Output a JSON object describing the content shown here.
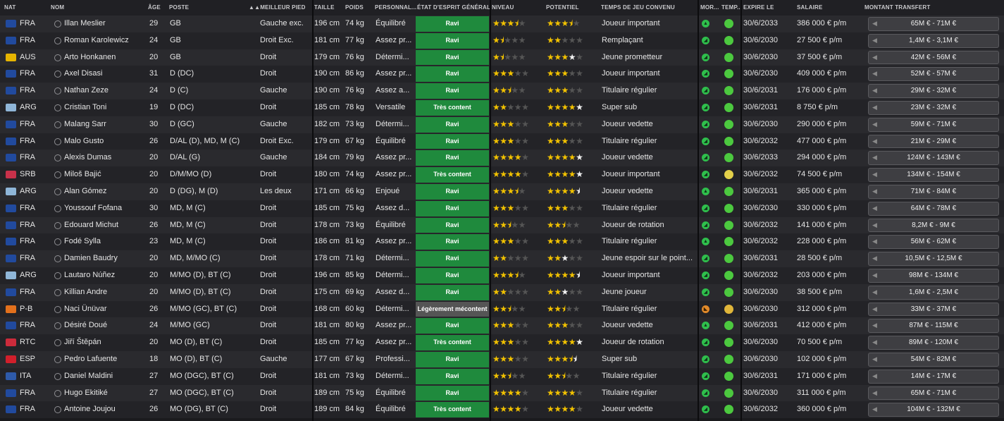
{
  "columns": {
    "nat": "NAT",
    "nom": "NOM",
    "age": "ÂGE",
    "poste": "POSTE",
    "meilleur_pied": "MEILLEUR PIED",
    "taille": "TAILLE",
    "poids": "POIDS",
    "personnalite": "PERSONNAL...",
    "etat_esprit": "ÉTAT D'ESPRIT GÉNÉRAL",
    "niveau": "NIVEAU",
    "potentiel": "POTENTIEL",
    "temps_jeu": "TEMPS DE JEU CONVENU",
    "moral": "MOR...",
    "temp": "TEMP...",
    "expire": "EXPIRE LE",
    "salaire": "SALAIRE",
    "transfert": "MONTANT TRANSFERT"
  },
  "players": [
    {
      "nat": "FRA",
      "nom": "Illan Meslier",
      "age": "29",
      "poste": "GB",
      "pied": "Gauche exc.",
      "taille": "196 cm",
      "poids": "74 kg",
      "perso": "Équilibré",
      "mood": "Ravi",
      "mood_kind": "ravi",
      "niveau": 3.5,
      "potentiel": 3.5,
      "temps": "Joueur important",
      "moral": "up",
      "happy": "happy",
      "expire": "30/6/2033",
      "salaire": "386 000 € p/m",
      "transfert": "65M € - 71M €"
    },
    {
      "nat": "FRA",
      "nom": "Roman Karolewicz",
      "age": "24",
      "poste": "GB",
      "pied": "Droit Exc.",
      "taille": "181 cm",
      "poids": "77 kg",
      "perso": "Assez pr...",
      "mood": "Ravi",
      "mood_kind": "ravi",
      "niveau": 1.5,
      "potentiel": 2,
      "temps": "Remplaçant",
      "moral": "ok",
      "happy": "happy",
      "expire": "30/6/2030",
      "salaire": "27 500 € p/m",
      "transfert": "1,4M € - 3,1M €"
    },
    {
      "nat": "AUS",
      "nom": "Arto Honkanen",
      "age": "20",
      "poste": "GB",
      "pied": "Droit",
      "taille": "179 cm",
      "poids": "76 kg",
      "perso": "Détermi...",
      "mood": "Ravi",
      "mood_kind": "ravi",
      "niveau": 1.5,
      "potentiel": 3,
      "potentiel_extra": 1,
      "temps": "Jeune prometteur",
      "moral": "ok",
      "happy": "happy",
      "expire": "30/6/2030",
      "salaire": "37 500 € p/m",
      "transfert": "42M € - 56M €"
    },
    {
      "nat": "FRA",
      "nom": "Axel Disasi",
      "age": "31",
      "poste": "D (DC)",
      "pied": "Droit",
      "taille": "190 cm",
      "poids": "86 kg",
      "perso": "Assez pr...",
      "mood": "Ravi",
      "mood_kind": "ravi",
      "niveau": 3,
      "potentiel": 3,
      "temps": "Joueur important",
      "moral": "ok",
      "happy": "happy",
      "expire": "30/6/2030",
      "salaire": "409 000 € p/m",
      "transfert": "52M € - 57M €"
    },
    {
      "nat": "FRA",
      "nom": "Nathan Zeze",
      "age": "24",
      "poste": "D (C)",
      "pied": "Gauche",
      "taille": "190 cm",
      "poids": "76 kg",
      "perso": "Assez a...",
      "mood": "Ravi",
      "mood_kind": "ravi",
      "niveau": 2.5,
      "potentiel": 3,
      "temps": "Titulaire régulier",
      "moral": "ok",
      "happy": "happy",
      "expire": "30/6/2031",
      "salaire": "176 000 € p/m",
      "transfert": "29M € - 32M €"
    },
    {
      "nat": "ARG",
      "nom": "Cristian Toni",
      "age": "19",
      "poste": "D (DC)",
      "pied": "Droit",
      "taille": "185 cm",
      "poids": "78 kg",
      "perso": "Versatile",
      "mood": "Très content",
      "mood_kind": "tres",
      "niveau": 2,
      "potentiel": 4,
      "potentiel_extra": 1,
      "temps": "Super sub",
      "moral": "ok",
      "happy": "happy",
      "expire": "30/6/2031",
      "salaire": "8 750 € p/m",
      "transfert": "23M € - 32M €"
    },
    {
      "nat": "FRA",
      "nom": "Malang Sarr",
      "age": "30",
      "poste": "D (GC)",
      "pied": "Gauche",
      "taille": "182 cm",
      "poids": "73 kg",
      "perso": "Détermi...",
      "mood": "Ravi",
      "mood_kind": "ravi",
      "niveau": 3,
      "potentiel": 3,
      "temps": "Joueur vedette",
      "moral": "ok",
      "happy": "happy",
      "expire": "30/6/2030",
      "salaire": "290 000 € p/m",
      "transfert": "59M € - 71M €"
    },
    {
      "nat": "FRA",
      "nom": "Malo Gusto",
      "age": "26",
      "poste": "D/AL (D), MD, M (C)",
      "pied": "Droit Exc.",
      "taille": "179 cm",
      "poids": "67 kg",
      "perso": "Équilibré",
      "mood": "Ravi",
      "mood_kind": "ravi",
      "niveau": 3,
      "potentiel": 3,
      "temps": "Titulaire régulier",
      "moral": "ok",
      "happy": "happy",
      "expire": "30/6/2032",
      "salaire": "477 000 € p/m",
      "transfert": "21M € - 29M €"
    },
    {
      "nat": "FRA",
      "nom": "Alexis Dumas",
      "age": "20",
      "poste": "D/AL (G)",
      "pied": "Gauche",
      "taille": "184 cm",
      "poids": "79 kg",
      "perso": "Assez pr...",
      "mood": "Ravi",
      "mood_kind": "ravi",
      "niveau": 4,
      "potentiel": 4,
      "potentiel_extra": 1,
      "temps": "Joueur vedette",
      "moral": "ok",
      "happy": "happy",
      "expire": "30/6/2033",
      "salaire": "294 000 € p/m",
      "transfert": "124M € - 143M €"
    },
    {
      "nat": "SRB",
      "nom": "Miloš Bajić",
      "age": "20",
      "poste": "D/M/MO (D)",
      "pied": "Droit",
      "taille": "180 cm",
      "poids": "74 kg",
      "perso": "Assez pr...",
      "mood": "Très content",
      "mood_kind": "tres",
      "niveau": 4,
      "potentiel": 4,
      "potentiel_extra": 1,
      "temps": "Joueur important",
      "moral": "ok",
      "happy": "neutral",
      "expire": "30/6/2032",
      "salaire": "74 500 € p/m",
      "transfert": "134M € - 154M €"
    },
    {
      "nat": "ARG",
      "nom": "Alan Gómez",
      "age": "20",
      "poste": "D (DG), M (D)",
      "pied": "Les deux",
      "taille": "171 cm",
      "poids": "66 kg",
      "perso": "Enjoué",
      "mood": "Ravi",
      "mood_kind": "ravi",
      "niveau": 3.5,
      "potentiel": 4,
      "potentiel_extra": 0.5,
      "temps": "Joueur vedette",
      "moral": "up",
      "happy": "happy",
      "expire": "30/6/2031",
      "salaire": "365 000 € p/m",
      "transfert": "71M € - 84M €"
    },
    {
      "nat": "FRA",
      "nom": "Youssouf Fofana",
      "age": "30",
      "poste": "MD, M (C)",
      "pied": "Droit",
      "taille": "185 cm",
      "poids": "75 kg",
      "perso": "Assez d...",
      "mood": "Ravi",
      "mood_kind": "ravi",
      "niveau": 3,
      "potentiel": 3,
      "temps": "Titulaire régulier",
      "moral": "ok",
      "happy": "happy",
      "expire": "30/6/2030",
      "salaire": "330 000 € p/m",
      "transfert": "64M € - 78M €"
    },
    {
      "nat": "FRA",
      "nom": "Edouard Michut",
      "age": "26",
      "poste": "MD, M (C)",
      "pied": "Droit",
      "taille": "178 cm",
      "poids": "73 kg",
      "perso": "Équilibré",
      "mood": "Ravi",
      "mood_kind": "ravi",
      "niveau": 2.5,
      "potentiel": 2.5,
      "temps": "Joueur de rotation",
      "moral": "ok",
      "happy": "happy",
      "expire": "30/6/2032",
      "salaire": "141 000 € p/m",
      "transfert": "8,2M € - 9M €"
    },
    {
      "nat": "FRA",
      "nom": "Fodé Sylla",
      "age": "23",
      "poste": "MD, M (C)",
      "pied": "Droit",
      "taille": "186 cm",
      "poids": "81 kg",
      "perso": "Assez pr...",
      "mood": "Ravi",
      "mood_kind": "ravi",
      "niveau": 3,
      "potentiel": 3,
      "temps": "Titulaire régulier",
      "moral": "up",
      "happy": "happy",
      "expire": "30/6/2032",
      "salaire": "228 000 € p/m",
      "transfert": "56M € - 62M €"
    },
    {
      "nat": "FRA",
      "nom": "Damien Baudry",
      "age": "20",
      "poste": "MD, M/MO (C)",
      "pied": "Droit",
      "taille": "178 cm",
      "poids": "71 kg",
      "perso": "Détermi...",
      "mood": "Ravi",
      "mood_kind": "ravi",
      "niveau": 2,
      "potentiel": 2,
      "potentiel_extra": 1,
      "temps": "Jeune espoir sur le point...",
      "moral": "ok",
      "happy": "happy",
      "expire": "30/6/2031",
      "salaire": "28 500 € p/m",
      "transfert": "10,5M € - 12,5M €"
    },
    {
      "nat": "ARG",
      "nom": "Lautaro Núñez",
      "age": "20",
      "poste": "M/MO (D), BT (C)",
      "pied": "Droit",
      "taille": "196 cm",
      "poids": "85 kg",
      "perso": "Détermi...",
      "mood": "Ravi",
      "mood_kind": "ravi",
      "niveau": 3.5,
      "potentiel": 4,
      "potentiel_extra": 0.5,
      "temps": "Joueur important",
      "moral": "ok",
      "happy": "happy",
      "expire": "30/6/2032",
      "salaire": "203 000 € p/m",
      "transfert": "98M € - 134M €"
    },
    {
      "nat": "FRA",
      "nom": "Killian Andre",
      "age": "20",
      "poste": "M/MO (D), BT (C)",
      "pied": "Droit",
      "taille": "175 cm",
      "poids": "69 kg",
      "perso": "Assez d...",
      "mood": "Ravi",
      "mood_kind": "ravi",
      "niveau": 2,
      "potentiel": 2,
      "potentiel_extra": 1,
      "temps": "Jeune joueur",
      "moral": "ok",
      "happy": "happy",
      "expire": "30/6/2030",
      "salaire": "38 500 € p/m",
      "transfert": "1,6M € - 2,5M €"
    },
    {
      "nat": "P-B",
      "nom": "Naci Ünüvar",
      "age": "26",
      "poste": "M/MO (GC), BT (C)",
      "pied": "Droit",
      "taille": "168 cm",
      "poids": "60 kg",
      "perso": "Détermi...",
      "mood": "Légèrement mécontent",
      "mood_kind": "leger",
      "niveau": 2.5,
      "potentiel": 2.5,
      "temps": "Titulaire régulier",
      "moral": "down",
      "happy": "sad",
      "expire": "30/6/2030",
      "salaire": "312 000 € p/m",
      "transfert": "33M € - 37M €"
    },
    {
      "nat": "FRA",
      "nom": "Désiré Doué",
      "age": "24",
      "poste": "M/MO (GC)",
      "pied": "Droit",
      "taille": "181 cm",
      "poids": "80 kg",
      "perso": "Assez pr...",
      "mood": "Ravi",
      "mood_kind": "ravi",
      "niveau": 3,
      "potentiel": 3,
      "temps": "Joueur vedette",
      "moral": "up",
      "happy": "happy",
      "expire": "30/6/2031",
      "salaire": "412 000 € p/m",
      "transfert": "87M € - 115M €"
    },
    {
      "nat": "RTC",
      "nom": "Jiří Štěpán",
      "age": "20",
      "poste": "MO (D), BT (C)",
      "pied": "Droit",
      "taille": "185 cm",
      "poids": "77 kg",
      "perso": "Assez pr...",
      "mood": "Très content",
      "mood_kind": "tres",
      "niveau": 3,
      "potentiel": 4,
      "potentiel_extra": 1,
      "temps": "Joueur de rotation",
      "moral": "ok",
      "happy": "happy",
      "expire": "30/6/2030",
      "salaire": "70 500 € p/m",
      "transfert": "89M € - 120M €"
    },
    {
      "nat": "ESP",
      "nom": "Pedro Lafuente",
      "age": "18",
      "poste": "MO (D), BT (C)",
      "pied": "Gauche",
      "taille": "177 cm",
      "poids": "67 kg",
      "perso": "Professi...",
      "mood": "Ravi",
      "mood_kind": "ravi",
      "niveau": 3,
      "potentiel": 3.5,
      "potentiel_extra": 0.5,
      "temps": "Super sub",
      "moral": "ok",
      "happy": "happy",
      "expire": "30/6/2030",
      "salaire": "102 000 € p/m",
      "transfert": "54M € - 82M €"
    },
    {
      "nat": "ITA",
      "nom": "Daniel Maldini",
      "age": "27",
      "poste": "MO (DGC), BT (C)",
      "pied": "Droit",
      "taille": "181 cm",
      "poids": "73 kg",
      "perso": "Détermi...",
      "mood": "Ravi",
      "mood_kind": "ravi",
      "niveau": 2.5,
      "potentiel": 2.5,
      "temps": "Titulaire régulier",
      "moral": "ok",
      "happy": "happy",
      "expire": "30/6/2031",
      "salaire": "171 000 € p/m",
      "transfert": "14M € - 17M €"
    },
    {
      "nat": "FRA",
      "nom": "Hugo Ekitiké",
      "age": "27",
      "poste": "MO (DGC), BT (C)",
      "pied": "Droit",
      "taille": "189 cm",
      "poids": "75 kg",
      "perso": "Équilibré",
      "mood": "Ravi",
      "mood_kind": "ravi",
      "niveau": 4,
      "potentiel": 4,
      "temps": "Titulaire régulier",
      "moral": "ok",
      "happy": "happy",
      "expire": "30/6/2030",
      "salaire": "311 000 € p/m",
      "transfert": "65M € - 71M €"
    },
    {
      "nat": "FRA",
      "nom": "Antoine Joujou",
      "age": "26",
      "poste": "MO (DG), BT (C)",
      "pied": "Droit",
      "taille": "189 cm",
      "poids": "84 kg",
      "perso": "Équilibré",
      "mood": "Très content",
      "mood_kind": "tres",
      "niveau": 4,
      "potentiel": 4,
      "temps": "Joueur vedette",
      "moral": "ok",
      "happy": "happy",
      "expire": "30/6/2032",
      "salaire": "360 000 € p/m",
      "transfert": "104M € - 132M €"
    }
  ]
}
